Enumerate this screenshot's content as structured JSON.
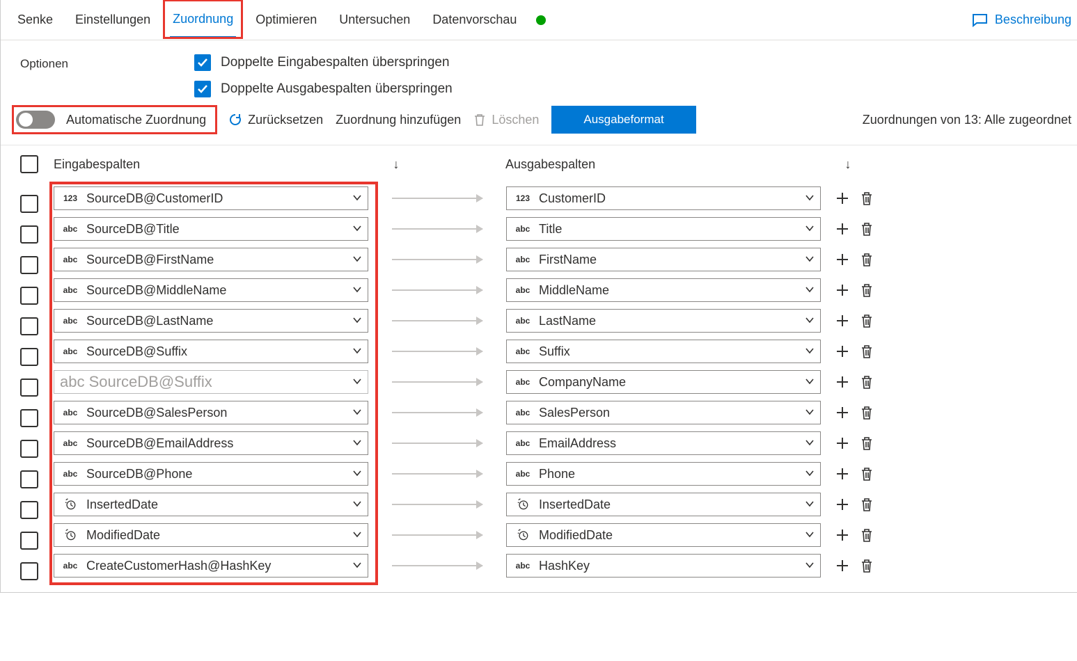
{
  "tabs": {
    "senke": "Senke",
    "einstellungen": "Einstellungen",
    "zuordnung": "Zuordnung",
    "optimieren": "Optimieren",
    "untersuchen": "Untersuchen",
    "datenvorschau": "Datenvorschau"
  },
  "header": {
    "beschreibung": "Beschreibung"
  },
  "options": {
    "label": "Optionen",
    "skipDupIn": "Doppelte Eingabespalten überspringen",
    "skipDupOut": "Doppelte Ausgabespalten überspringen"
  },
  "actions": {
    "autoMap": "Automatische Zuordnung",
    "reset": "Zurücksetzen",
    "addMap": "Zuordnung hinzufügen",
    "delete": "Löschen",
    "outputFormat": "Ausgabeformat",
    "status": "Zuordnungen von 13: Alle zugeordnet"
  },
  "columns": {
    "input": "Eingabespalten",
    "output": "Ausgabespalten",
    "sort": "↓"
  },
  "rows": [
    {
      "inType": "123",
      "in": "SourceDB@CustomerID",
      "outType": "123",
      "out": "CustomerID"
    },
    {
      "inType": "abc",
      "in": "SourceDB@Title",
      "outType": "abc",
      "out": "Title"
    },
    {
      "inType": "abc",
      "in": "SourceDB@FirstName",
      "outType": "abc",
      "out": "FirstName"
    },
    {
      "inType": "abc",
      "in": "SourceDB@MiddleName",
      "outType": "abc",
      "out": "MiddleName"
    },
    {
      "inType": "abc",
      "in": "SourceDB@LastName",
      "outType": "abc",
      "out": "LastName"
    },
    {
      "inType": "abc",
      "in": "SourceDB@Suffix",
      "outType": "abc",
      "out": "Suffix"
    },
    {
      "inType": "abc",
      "in": "SourceDB@Suffix",
      "outType": "abc",
      "out": "CompanyName",
      "ghost": true
    },
    {
      "inType": "abc",
      "in": "SourceDB@SalesPerson",
      "outType": "abc",
      "out": "SalesPerson"
    },
    {
      "inType": "abc",
      "in": "SourceDB@EmailAddress",
      "outType": "abc",
      "out": "EmailAddress"
    },
    {
      "inType": "abc",
      "in": "SourceDB@Phone",
      "outType": "abc",
      "out": "Phone"
    },
    {
      "inType": "time",
      "in": "InsertedDate",
      "outType": "time",
      "out": "InsertedDate"
    },
    {
      "inType": "time",
      "in": "ModifiedDate",
      "outType": "time",
      "out": "ModifiedDate"
    },
    {
      "inType": "abc",
      "in": "CreateCustomerHash@HashKey",
      "outType": "abc",
      "out": "HashKey"
    }
  ],
  "ghostPlaceholder": "abc SourceDB@Suffix"
}
